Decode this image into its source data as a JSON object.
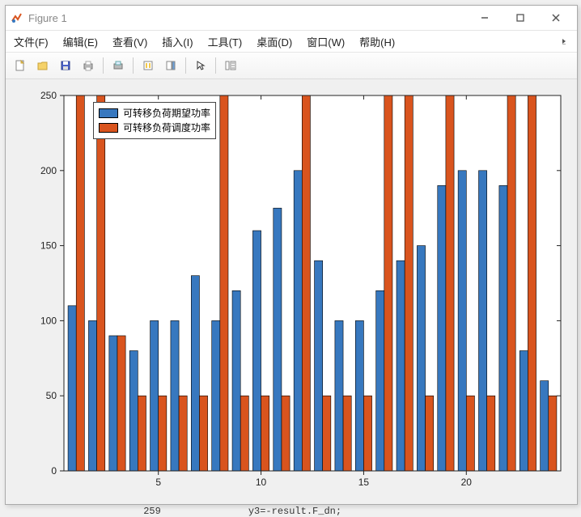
{
  "window": {
    "title": "Figure 1"
  },
  "menubar": {
    "items": [
      "文件(F)",
      "编辑(E)",
      "查看(V)",
      "插入(I)",
      "工具(T)",
      "桌面(D)",
      "窗口(W)",
      "帮助(H)"
    ]
  },
  "toolbar": {
    "icons": [
      "new-file-icon",
      "open-file-icon",
      "save-icon",
      "print-icon",
      "sep",
      "print-figure-icon",
      "sep",
      "link-axes-icon",
      "insert-colorbar-icon",
      "sep",
      "cursor-icon",
      "sep",
      "plot-tools-icon"
    ]
  },
  "chart_data": {
    "type": "bar",
    "categories": [
      1,
      2,
      3,
      4,
      5,
      6,
      7,
      8,
      9,
      10,
      11,
      12,
      13,
      14,
      15,
      16,
      17,
      18,
      19,
      20,
      21,
      22,
      23,
      24
    ],
    "series": [
      {
        "name": "可转移负荷期望功率",
        "color": "#3778bf",
        "values": [
          110,
          100,
          90,
          80,
          100,
          100,
          130,
          100,
          120,
          160,
          175,
          200,
          140,
          100,
          100,
          120,
          140,
          150,
          190,
          200,
          200,
          190,
          80,
          60
        ]
      },
      {
        "name": "可转移负荷调度功率",
        "color": "#d9541e",
        "values": [
          250,
          250,
          90,
          50,
          50,
          50,
          50,
          250,
          50,
          50,
          50,
          250,
          50,
          50,
          50,
          250,
          250,
          50,
          250,
          50,
          50,
          250,
          250,
          50
        ]
      }
    ],
    "xticks": [
      5,
      10,
      15,
      20
    ],
    "yticks": [
      0,
      50,
      100,
      150,
      200,
      250
    ],
    "xlim": [
      0.4,
      24.6
    ],
    "ylim": [
      0,
      250
    ],
    "xlabel": "",
    "ylabel": ""
  },
  "legend": {
    "items": [
      {
        "label": "可转移负荷期望功率",
        "color": "#3778bf"
      },
      {
        "label": "可转移负荷调度功率",
        "color": "#d9541e"
      }
    ]
  },
  "behind": {
    "line": " 259               y3=-result.F_dn;"
  }
}
